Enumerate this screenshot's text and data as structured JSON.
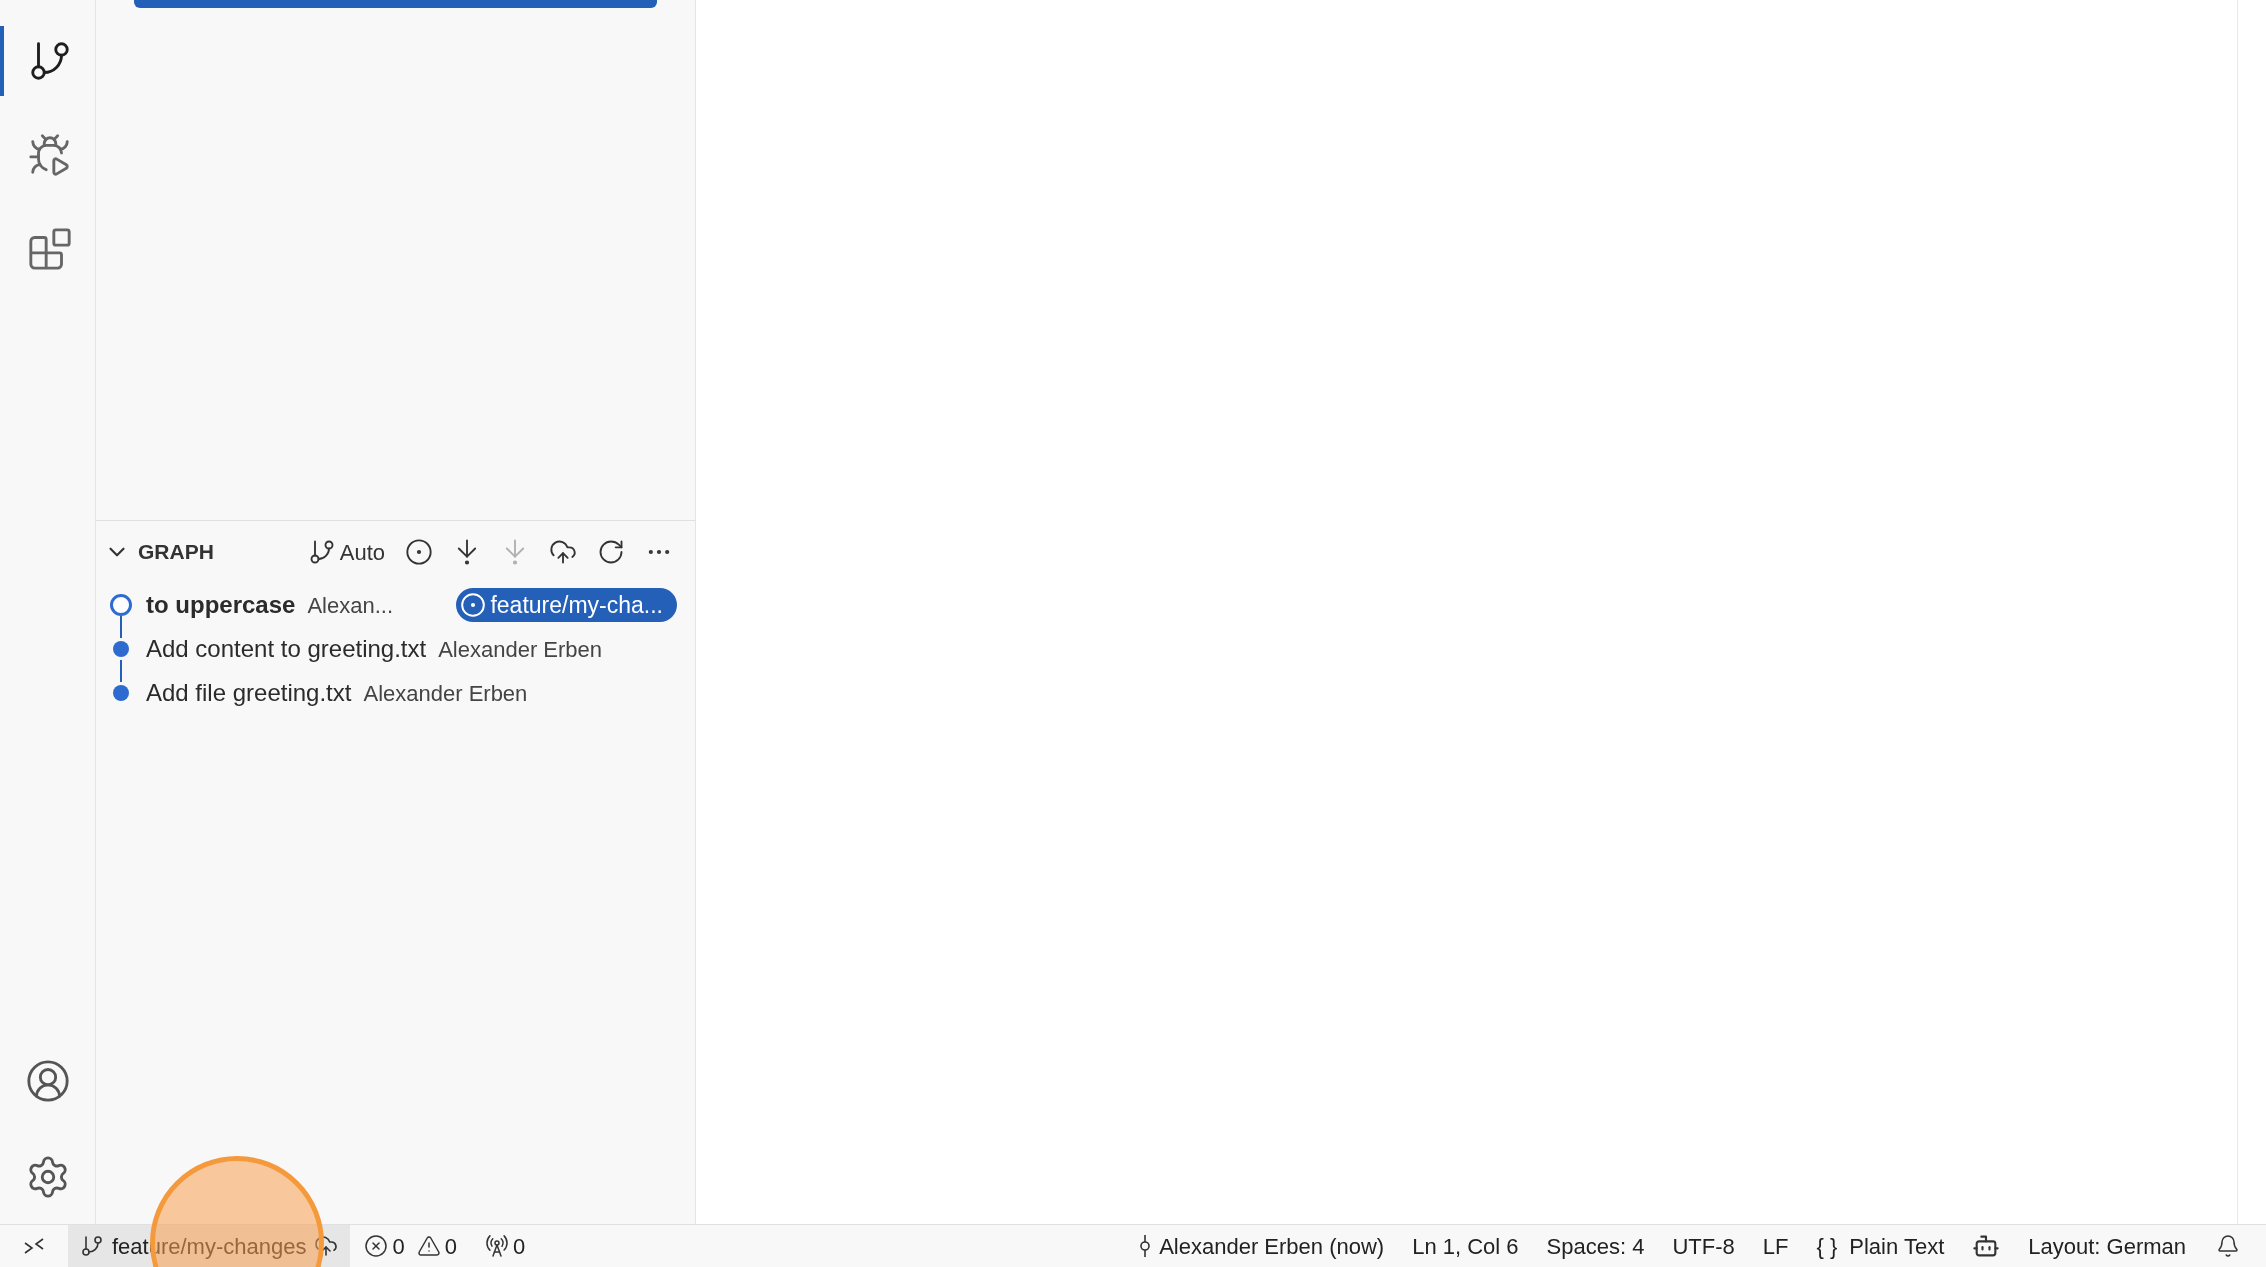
{
  "activity_bar": {
    "items": [
      {
        "kind": "source-control",
        "selected": true
      },
      {
        "kind": "run-debug",
        "selected": false
      },
      {
        "kind": "extensions",
        "selected": false
      }
    ],
    "bottom": [
      {
        "kind": "account"
      },
      {
        "kind": "settings"
      }
    ]
  },
  "graph": {
    "title": "GRAPH",
    "expanded": true,
    "toolbar": [
      {
        "kind": "branch-mode",
        "text": "Auto",
        "disabled": false
      },
      {
        "kind": "target",
        "disabled": false
      },
      {
        "kind": "fetch",
        "disabled": false
      },
      {
        "kind": "pull",
        "disabled": true
      },
      {
        "kind": "push",
        "disabled": false
      },
      {
        "kind": "refresh",
        "disabled": false
      },
      {
        "kind": "more",
        "disabled": false
      }
    ],
    "commits": [
      {
        "message": "to uppercase",
        "author": "Alexan...",
        "current": true,
        "branch": "feature/my-cha..."
      },
      {
        "message": "Add content to greeting.txt",
        "author": "Alexander Erben",
        "current": false
      },
      {
        "message": "Add file greeting.txt",
        "author": "Alexander Erben",
        "current": false
      }
    ]
  },
  "status_bar": {
    "left": [
      {
        "kind": "remote"
      },
      {
        "kind": "branch",
        "text": "feature/my-changes"
      },
      {
        "kind": "problems",
        "errors": "0",
        "warnings": "0"
      },
      {
        "kind": "ports",
        "text": "0"
      }
    ],
    "right": [
      {
        "kind": "blame",
        "text": "Alexander Erben (now)"
      },
      {
        "kind": "text",
        "text": "Ln 1, Col 6"
      },
      {
        "kind": "text",
        "text": "Spaces: 4"
      },
      {
        "kind": "text",
        "text": "UTF-8"
      },
      {
        "kind": "text",
        "text": "LF"
      },
      {
        "kind": "language",
        "glyph": "{ }",
        "text": "Plain Text"
      },
      {
        "kind": "copilot"
      },
      {
        "kind": "text",
        "text": "Layout: German"
      },
      {
        "kind": "bell"
      }
    ]
  }
}
